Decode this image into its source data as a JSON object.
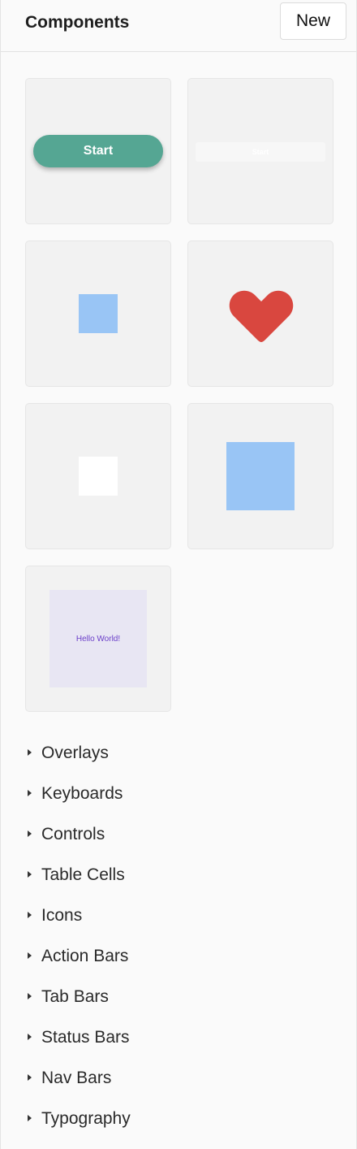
{
  "header": {
    "title": "Components",
    "new_label": "New"
  },
  "components": {
    "start_button_label": "Start",
    "ghost_button_label": "Start",
    "hello_text": "Hello World!",
    "colors": {
      "start_green": "#55a693",
      "light_blue": "#99c5f5",
      "heart_red": "#d9473f",
      "lavender": "#e8e6f3",
      "purple_text": "#6b3fc9"
    }
  },
  "sections": [
    {
      "label": "Overlays"
    },
    {
      "label": "Keyboards"
    },
    {
      "label": "Controls"
    },
    {
      "label": "Table Cells"
    },
    {
      "label": "Icons"
    },
    {
      "label": "Action Bars"
    },
    {
      "label": "Tab Bars"
    },
    {
      "label": "Status Bars"
    },
    {
      "label": "Nav Bars"
    },
    {
      "label": "Typography"
    }
  ]
}
